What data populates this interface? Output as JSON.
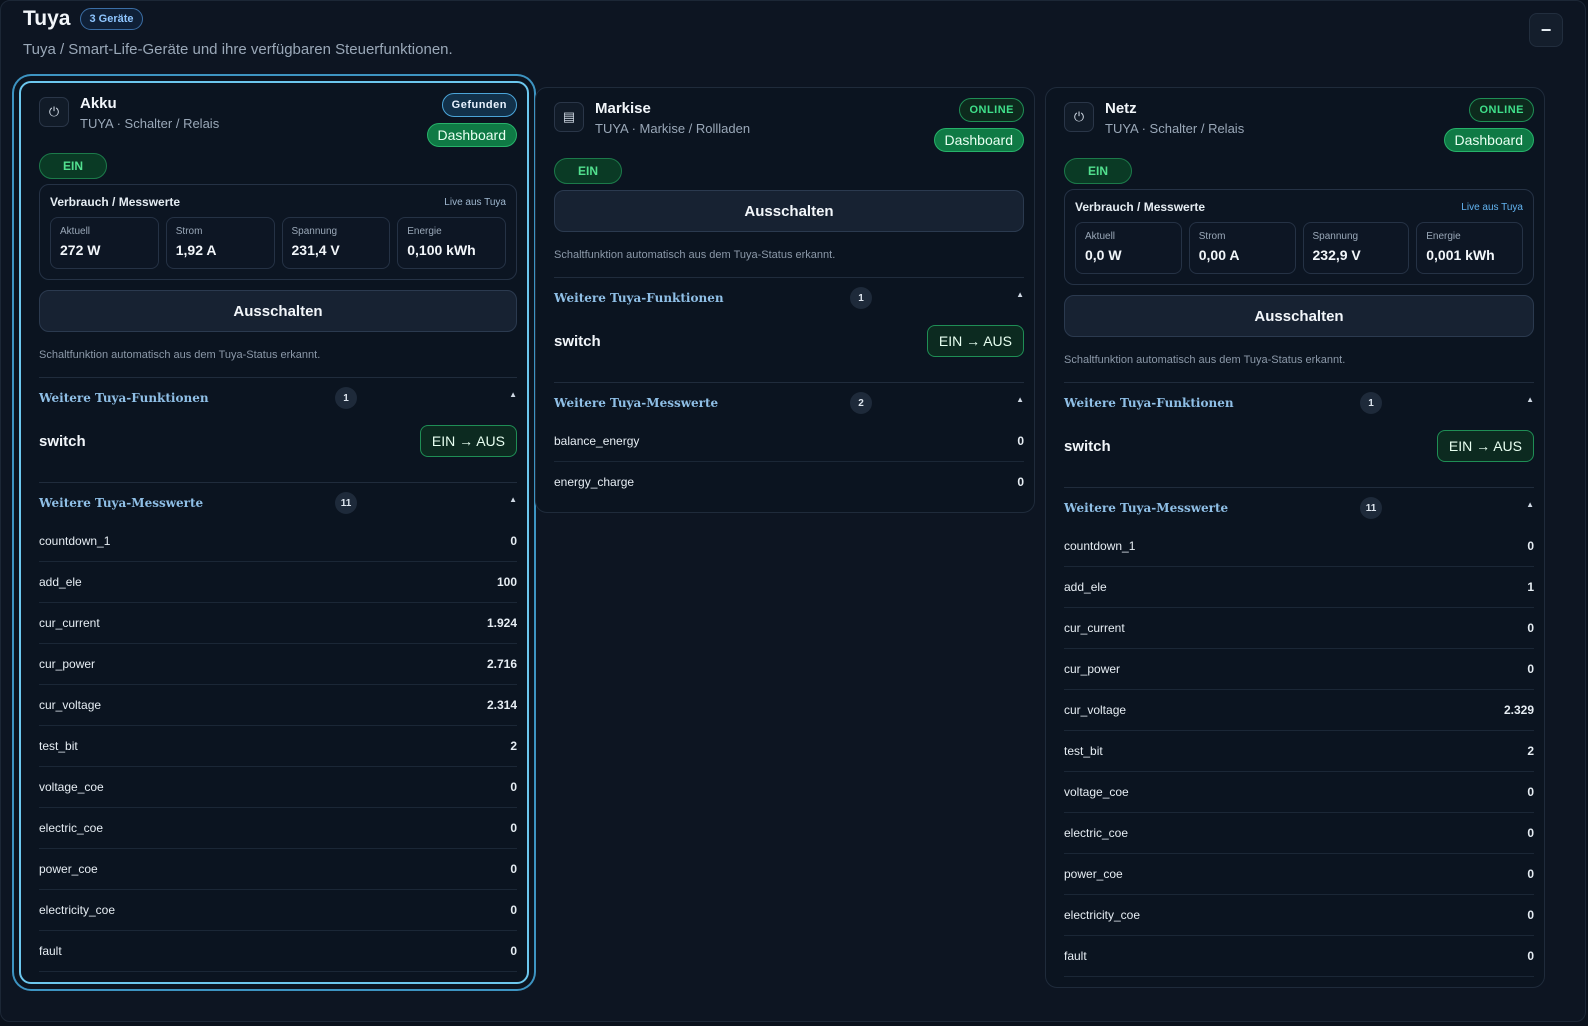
{
  "header": {
    "title": "Tuya",
    "device_count": "3 Geräte",
    "subtitle": "Tuya / Smart-Life-Geräte und ihre verfügbaren Steuerfunktionen.",
    "collapse_icon": "minus-icon",
    "collapse_symbol": "−"
  },
  "colors": {
    "accent": "#6cc7ee",
    "online": "#3fe08a",
    "dashboard": "#0f7a45",
    "background": "#0a111c"
  },
  "devices": [
    {
      "name": "Akku",
      "type": "TUYA · Schalter / Relais",
      "icon": "power-icon",
      "icon_symbol": "⏻",
      "status": "Gefunden",
      "dashboard": "Dashboard",
      "state": "EIN",
      "meter": {
        "title": "Verbrauch / Messwerte",
        "live": "Live aus Tuya",
        "cells": [
          {
            "label": "Aktuell",
            "value": "272 W"
          },
          {
            "label": "Strom",
            "value": "1,92 A"
          },
          {
            "label": "Spannung",
            "value": "231,4 V"
          },
          {
            "label": "Energie",
            "value": "0,100 kWh"
          }
        ]
      },
      "action": "Ausschalten",
      "hint": "Schaltfunktion automatisch aus dem Tuya-Status erkannt.",
      "functions": {
        "title": "Weitere Tuya-Funktionen",
        "count": "1",
        "items": [
          {
            "name": "switch",
            "action": "EIN → AUS"
          }
        ]
      },
      "values": {
        "title": "Weitere Tuya-Messwerte",
        "count": "11",
        "items": [
          {
            "k": "countdown_1",
            "v": "0"
          },
          {
            "k": "add_ele",
            "v": "100"
          },
          {
            "k": "cur_current",
            "v": "1.924"
          },
          {
            "k": "cur_power",
            "v": "2.716"
          },
          {
            "k": "cur_voltage",
            "v": "2.314"
          },
          {
            "k": "test_bit",
            "v": "2"
          },
          {
            "k": "voltage_coe",
            "v": "0"
          },
          {
            "k": "electric_coe",
            "v": "0"
          },
          {
            "k": "power_coe",
            "v": "0"
          },
          {
            "k": "electricity_coe",
            "v": "0"
          },
          {
            "k": "fault",
            "v": "0"
          }
        ]
      }
    },
    {
      "name": "Markise",
      "type": "TUYA · Markise / Rollladen",
      "icon": "blinds-icon",
      "icon_symbol": "▤",
      "status": "ONLINE",
      "dashboard": "Dashboard",
      "state": "EIN",
      "action": "Ausschalten",
      "hint": "Schaltfunktion automatisch aus dem Tuya-Status erkannt.",
      "functions": {
        "title": "Weitere Tuya-Funktionen",
        "count": "1",
        "items": [
          {
            "name": "switch",
            "action": "EIN → AUS"
          }
        ]
      },
      "values": {
        "title": "Weitere Tuya-Messwerte",
        "count": "2",
        "items": [
          {
            "k": "balance_energy",
            "v": "0"
          },
          {
            "k": "energy_charge",
            "v": "0"
          }
        ]
      }
    },
    {
      "name": "Netz",
      "type": "TUYA · Schalter / Relais",
      "icon": "power-icon",
      "icon_symbol": "⏻",
      "status": "ONLINE",
      "dashboard": "Dashboard",
      "state": "EIN",
      "meter": {
        "title": "Verbrauch / Messwerte",
        "live": "Live aus Tuya",
        "cells": [
          {
            "label": "Aktuell",
            "value": "0,0 W"
          },
          {
            "label": "Strom",
            "value": "0,00 A"
          },
          {
            "label": "Spannung",
            "value": "232,9 V"
          },
          {
            "label": "Energie",
            "value": "0,001 kWh"
          }
        ]
      },
      "action": "Ausschalten",
      "hint": "Schaltfunktion automatisch aus dem Tuya-Status erkannt.",
      "functions": {
        "title": "Weitere Tuya-Funktionen",
        "count": "1",
        "items": [
          {
            "name": "switch",
            "action": "EIN → AUS"
          }
        ]
      },
      "values": {
        "title": "Weitere Tuya-Messwerte",
        "count": "11",
        "items": [
          {
            "k": "countdown_1",
            "v": "0"
          },
          {
            "k": "add_ele",
            "v": "1"
          },
          {
            "k": "cur_current",
            "v": "0"
          },
          {
            "k": "cur_power",
            "v": "0"
          },
          {
            "k": "cur_voltage",
            "v": "2.329"
          },
          {
            "k": "test_bit",
            "v": "2"
          },
          {
            "k": "voltage_coe",
            "v": "0"
          },
          {
            "k": "electric_coe",
            "v": "0"
          },
          {
            "k": "power_coe",
            "v": "0"
          },
          {
            "k": "electricity_coe",
            "v": "0"
          },
          {
            "k": "fault",
            "v": "0"
          }
        ]
      }
    }
  ]
}
